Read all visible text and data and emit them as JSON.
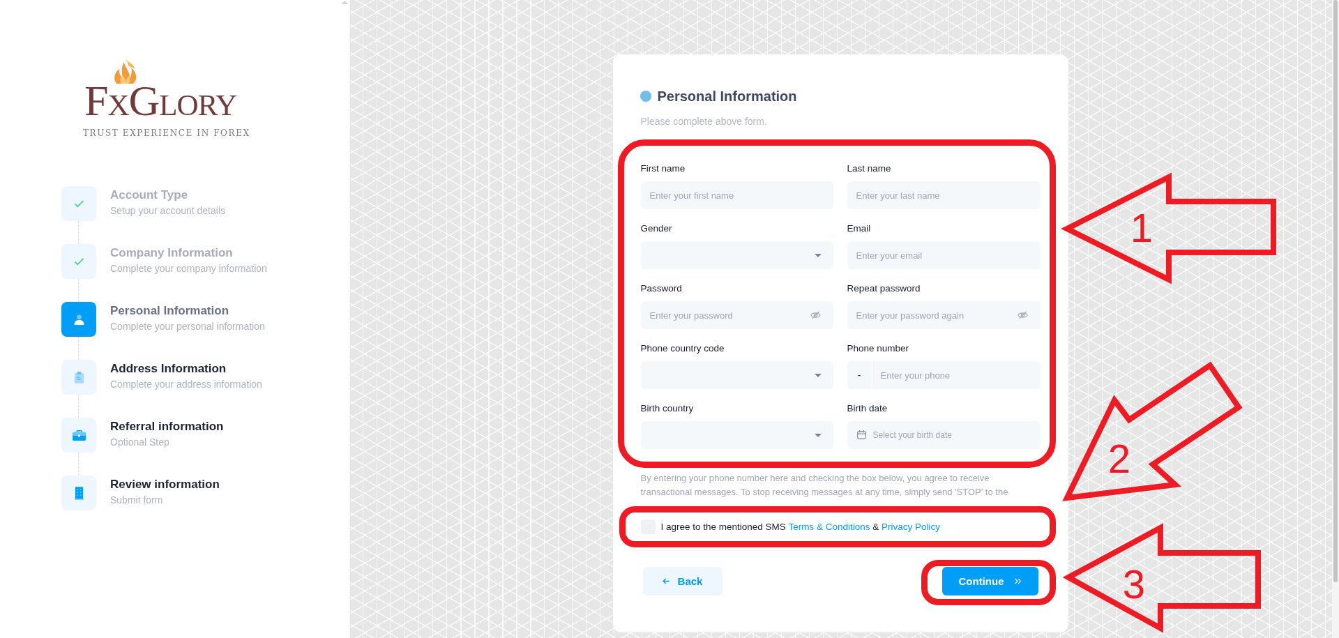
{
  "logo": {
    "wordmark": "FxGlory",
    "tagline": "TRUST EXPERIENCE IN FOREX"
  },
  "steps": [
    {
      "title": "Account Type",
      "subtitle": "Setup your account details",
      "completed": true,
      "selected": false
    },
    {
      "title": "Company Information",
      "subtitle": "Complete your company information",
      "completed": true,
      "selected": false
    },
    {
      "title": "Personal Information",
      "subtitle": "Complete your personal information",
      "completed": false,
      "selected": true
    },
    {
      "title": "Address Information",
      "subtitle": "Complete your address information",
      "completed": false,
      "selected": false
    },
    {
      "title": "Referral information",
      "subtitle": "Optional Step",
      "completed": false,
      "selected": false
    },
    {
      "title": "Review information",
      "subtitle": "Submit form",
      "completed": false,
      "selected": false
    }
  ],
  "form": {
    "title": "Personal Information",
    "subtitle": "Please complete above form.",
    "fields": [
      {
        "label": "First name",
        "kind": "text",
        "placeholder": "Enter your first name"
      },
      {
        "label": "Last name",
        "kind": "text",
        "placeholder": "Enter your last name"
      },
      {
        "label": "Gender",
        "kind": "select"
      },
      {
        "label": "Email",
        "kind": "text",
        "placeholder": "Enter your email"
      },
      {
        "label": "Password",
        "kind": "password",
        "placeholder": "Enter your password"
      },
      {
        "label": "Repeat password",
        "kind": "password",
        "placeholder": "Enter your password again"
      },
      {
        "label": "Phone country code",
        "kind": "select"
      },
      {
        "label": "Phone number",
        "kind": "phone",
        "prefix": "-",
        "placeholder": "Enter your phone"
      },
      {
        "label": "Birth country",
        "kind": "select"
      },
      {
        "label": "Birth date",
        "kind": "date",
        "placeholder": "Select your birth date"
      }
    ],
    "notice": "By entering your phone number here and checking the box below, you agree to receive transactional messages. To stop receiving messages at any time, simply send 'STOP' to the",
    "consent": {
      "checked": false,
      "parts": [
        {
          "kind": "text",
          "text": "I agree to the mentioned SMS"
        },
        {
          "kind": "link",
          "text": "Terms & Conditions"
        },
        {
          "kind": "text",
          "text": "&"
        },
        {
          "kind": "link",
          "text": "Privacy Policy"
        }
      ]
    },
    "buttons": [
      {
        "label": "Back",
        "kind": "secondary"
      },
      {
        "label": "Continue",
        "kind": "primary"
      }
    ]
  },
  "annotations": [
    {
      "number": "1"
    },
    {
      "number": "2"
    },
    {
      "number": "3"
    }
  ]
}
